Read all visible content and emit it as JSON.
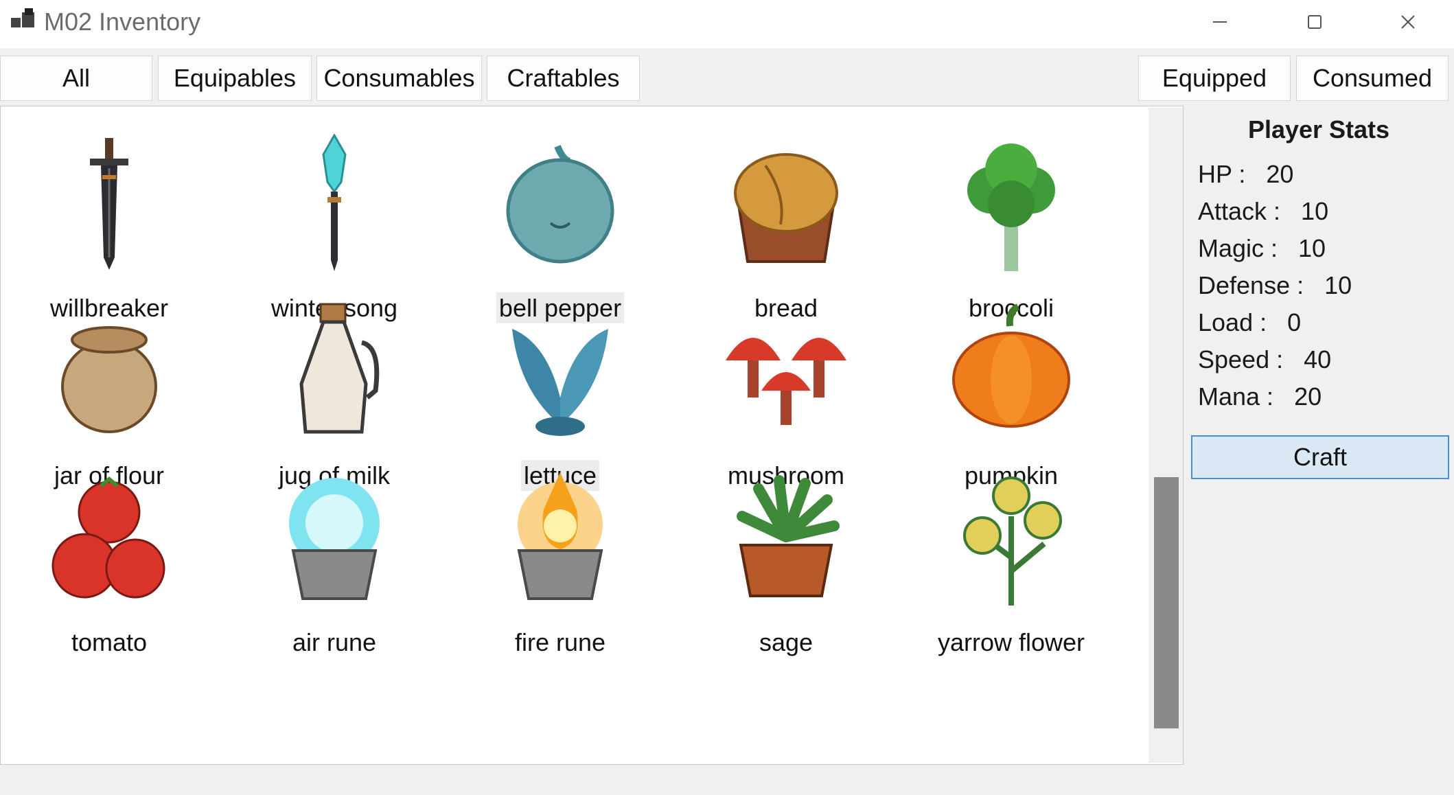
{
  "window": {
    "title": "M02 Inventory"
  },
  "tabs": {
    "all": "All",
    "equipables": "Equipables",
    "consumables": "Consumables",
    "craftables": "Craftables",
    "equipped": "Equipped",
    "consumed": "Consumed"
  },
  "items": [
    {
      "name": "willbreaker",
      "icon": "sword-icon"
    },
    {
      "name": "winter song",
      "icon": "ice-staff-icon"
    },
    {
      "name": "bell pepper",
      "icon": "bell-pepper-icon",
      "highlighted": true
    },
    {
      "name": "bread",
      "icon": "bread-icon"
    },
    {
      "name": "broccoli",
      "icon": "broccoli-icon"
    },
    {
      "name": "jar of flour",
      "icon": "flour-jar-icon"
    },
    {
      "name": "jug of milk",
      "icon": "milk-jug-icon"
    },
    {
      "name": "lettuce",
      "icon": "lettuce-icon",
      "highlighted": true
    },
    {
      "name": "mushroom",
      "icon": "mushroom-icon"
    },
    {
      "name": "pumpkin",
      "icon": "pumpkin-icon"
    },
    {
      "name": "tomato",
      "icon": "tomato-icon"
    },
    {
      "name": "air rune",
      "icon": "air-rune-icon"
    },
    {
      "name": "fire rune",
      "icon": "fire-rune-icon"
    },
    {
      "name": "sage",
      "icon": "sage-icon"
    },
    {
      "name": "yarrow flower",
      "icon": "yarrow-flower-icon"
    }
  ],
  "stats": {
    "title": "Player Stats",
    "hp": "HP :   20",
    "attack": "Attack :   10",
    "magic": "Magic :   10",
    "defense": "Defense :   10",
    "load": "Load :   0",
    "speed": "Speed :   40",
    "mana": "Mana :   20"
  },
  "craft_label": "Craft",
  "colors": {
    "craft_bg": "#dbe9f6",
    "craft_border": "#4a8fd0",
    "scroll_thumb": "#8a8a8a"
  }
}
